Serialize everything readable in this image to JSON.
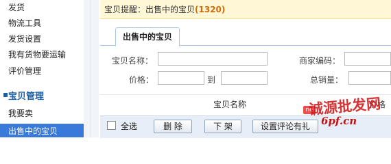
{
  "sidebar": {
    "items_top": [
      "发货",
      "物流工具",
      "发货设置",
      "我有货物要运输",
      "评价管理"
    ],
    "section_title": "宝贝管理",
    "items_bottom": [
      "我要卖",
      "出售中的宝贝"
    ]
  },
  "alert": {
    "prefix": "宝贝提醒：出售中的宝贝",
    "count": "(1320)"
  },
  "tab": {
    "label": "出售中的宝贝"
  },
  "filters": {
    "name_label": "宝贝名称：",
    "code_label": "商家编码：",
    "price_label": "价格：",
    "to_label": "到",
    "sales_label": "总销量："
  },
  "table": {
    "col_name": "宝贝名称",
    "col_price": "价格",
    "badge": "ne"
  },
  "toolbar": {
    "select_all": "全选",
    "delete": "删 除",
    "offshelf": "下 架",
    "comment_gift": "设置评论有礼"
  },
  "watermark": {
    "main": "诚源批发网",
    "sub": "6pf.cn"
  },
  "colors": {
    "selected_bg": "#3879d9",
    "alert_count": "#d46b08",
    "section_title": "#1a5ea8"
  }
}
